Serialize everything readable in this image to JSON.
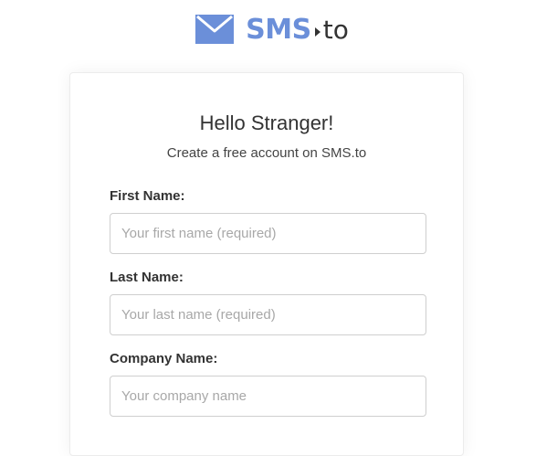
{
  "logo": {
    "brand": "SMS",
    "tld": "to",
    "icon": "envelope-icon",
    "brand_color": "#6b8fd9"
  },
  "form": {
    "title": "Hello Stranger!",
    "subtitle": "Create a free account on SMS.to",
    "fields": [
      {
        "label": "First Name:",
        "placeholder": "Your first name (required)",
        "value": ""
      },
      {
        "label": "Last Name:",
        "placeholder": "Your last name (required)",
        "value": ""
      },
      {
        "label": "Company Name:",
        "placeholder": "Your company name",
        "value": ""
      }
    ]
  }
}
